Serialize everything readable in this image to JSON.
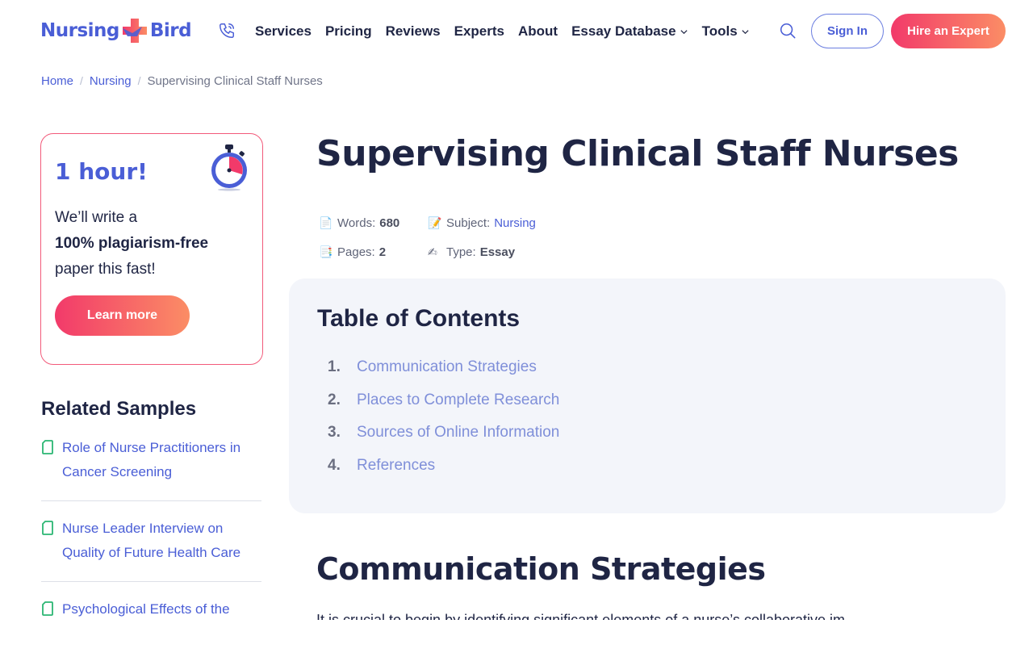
{
  "header": {
    "logo": {
      "part1": "Nursing",
      "part2": "Bird"
    },
    "icons": {
      "phone": "phone-icon",
      "search": "search-icon",
      "chevron": "chevron-down-icon"
    },
    "nav": [
      {
        "label": "Services"
      },
      {
        "label": "Pricing"
      },
      {
        "label": "Reviews"
      },
      {
        "label": "Experts"
      },
      {
        "label": "About"
      },
      {
        "label": "Essay Database"
      },
      {
        "label": "Tools"
      }
    ],
    "sign_in": "Sign In",
    "hire": "Hire an Expert"
  },
  "breadcrumb": {
    "items": [
      "Home",
      "Nursing"
    ],
    "separator": "/",
    "current": "Supervising Clinical Staff Nurses"
  },
  "promo": {
    "title": "1 hour!",
    "line1": "We’ll write a",
    "line2": "100% plagiarism-free",
    "line3": "paper this fast!",
    "button": "Learn more",
    "icon": "stopwatch-icon"
  },
  "related": {
    "title": "Related Samples",
    "items": [
      {
        "label": "Role of Nurse Practitioners in Cancer Screening"
      },
      {
        "label": "Nurse Leader Interview on Quality of Future Health Care"
      },
      {
        "label": "Psychological Effects of the"
      }
    ]
  },
  "article": {
    "title": "Supervising Clinical Staff Nurses",
    "meta": {
      "words_label": "Words:",
      "words": "680",
      "subject_label": "Subject:",
      "subject": "Nursing",
      "pages_label": "Pages:",
      "pages": "2",
      "type_label": "Type:",
      "type": "Essay"
    },
    "toc": {
      "title": "Table of Contents",
      "items": [
        {
          "num": "1.",
          "label": "Communication Strategies"
        },
        {
          "num": "2.",
          "label": "Places to Complete Research"
        },
        {
          "num": "3.",
          "label": "Sources of Online Information"
        },
        {
          "num": "4.",
          "label": "References"
        }
      ]
    },
    "section_title": "Communication Strategies",
    "body_start": "It is crucial to begin by identifying significant elements of a nurse’s collaborative im"
  },
  "colors": {
    "brand": "#4a5ed6",
    "accent_gradient_start": "#f23a6a",
    "accent_gradient_end": "#fb8d65",
    "text_dark": "#1f2544"
  }
}
